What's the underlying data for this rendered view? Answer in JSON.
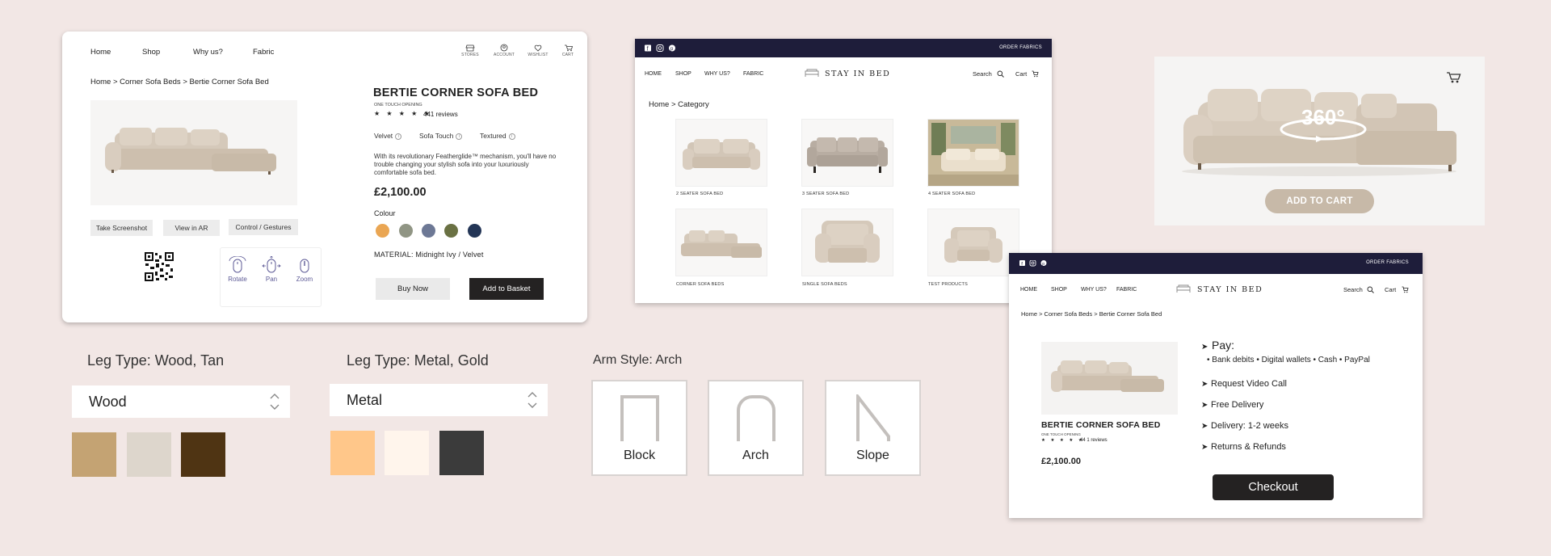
{
  "product_page": {
    "nav": [
      "Home",
      "Shop",
      "Why us?",
      "Fabric"
    ],
    "top_icons": [
      {
        "icon": "store-icon",
        "label": "STORES"
      },
      {
        "icon": "account-icon",
        "label": "ACCOUNT"
      },
      {
        "icon": "heart-icon",
        "label": "WISHLIST"
      },
      {
        "icon": "cart-icon",
        "label": "CART"
      }
    ],
    "breadcrumb": "Home > Corner Sofa Beds > Bertie Corner Sofa Bed",
    "buttons": {
      "screenshot": "Take Screenshot",
      "ar": "View in AR",
      "gestures": "Control / Gestures"
    },
    "gestures": [
      "Rotate",
      "Pan",
      "Zoom"
    ],
    "title": "BERTIE CORNER SOFA BED",
    "subtitle": "ONE TOUCH OPENING",
    "stars": "★ ★ ★ ★ ★",
    "reviews": "441 reviews",
    "fabrics": [
      "Velvet",
      "Sofa Touch",
      "Textured"
    ],
    "info_glyph": "i",
    "description": "With its revolutionary Featherglide™ mechanism, you'll have no trouble changing your stylish sofa into your luxuriously comfortable sofa bed.",
    "price": "£2,100.00",
    "colour_label": "Colour",
    "colours": [
      "#eaa653",
      "#909584",
      "#6d7895",
      "#6a7143",
      "#233556"
    ],
    "material": "MATERIAL: Midnight Ivy / Velvet",
    "buy_now": "Buy Now",
    "add_to_basket": "Add to Basket"
  },
  "category_page": {
    "order_fabrics": "ORDER FABRICS",
    "nav": [
      "HOME",
      "SHOP",
      "WHY US?",
      "FABRIC"
    ],
    "brand": "STAY IN BED",
    "search": "Search",
    "cart": "Cart",
    "breadcrumb": "Home > Category",
    "items": [
      "2 SEATER SOFA BED",
      "3 SEATER SOFA BED",
      "4 SEATER SOFA BED",
      "CORNER SOFA BEDS",
      "SINGLE SOFA BEDS",
      "TEST PRODUCTS"
    ]
  },
  "viewer_360": {
    "label": "360°",
    "add_to_cart": "ADD TO CART"
  },
  "checkout_page": {
    "order_fabrics": "ORDER FABRICS",
    "nav": [
      "HOME",
      "SHOP",
      "WHY US?",
      "FABRIC"
    ],
    "brand": "STAY IN BED",
    "search": "Search",
    "cart": "Cart",
    "breadcrumb": "Home > Corner Sofa Beds > Bertie Corner Sofa Bed",
    "title": "BERTIE CORNER SOFA BED",
    "subtitle": "ONE TOUCH OPENING",
    "stars": "★ ★ ★ ★ ★",
    "reviews": "44 1 reviews",
    "price": "£2,100.00",
    "pay_label": "Pay:",
    "payment_methods": "• Bank debits    • Digital wallets    • Cash    • PayPal",
    "bullet": "➤",
    "features": [
      "Request Video Call",
      "Free Delivery",
      "Delivery: 1-2 weeks",
      "Returns & Refunds"
    ],
    "checkout": "Checkout"
  },
  "leg_wood": {
    "label": "Leg Type: Wood, Tan",
    "value": "Wood",
    "swatches": [
      "#c4a373",
      "#ddd6cc",
      "#4f3413"
    ]
  },
  "leg_metal": {
    "label": "Leg Type: Metal, Gold",
    "value": "Metal",
    "swatches": [
      "#ffc78a",
      "#fff5ec",
      "#3b3b3b"
    ]
  },
  "arm_style": {
    "label": "Arm Style: Arch",
    "options": [
      "Block",
      "Arch",
      "Slope"
    ]
  }
}
